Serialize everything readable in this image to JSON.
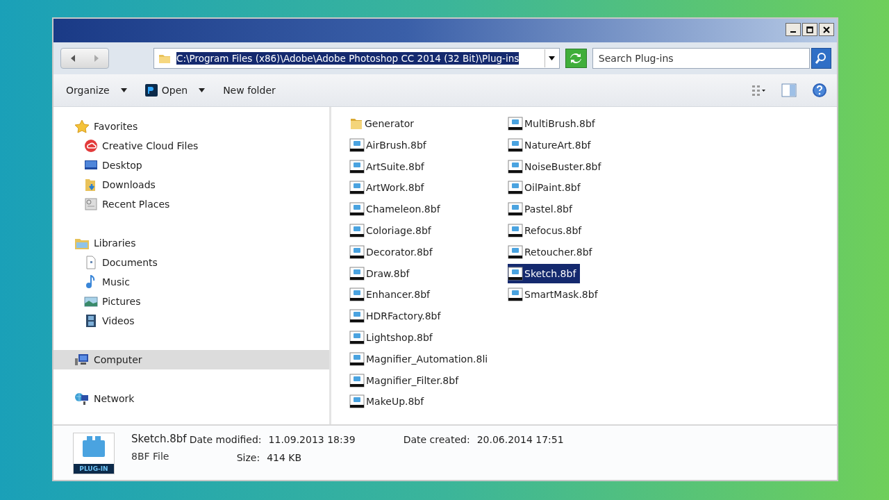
{
  "address_bar": {
    "path": "C:\\Program Files (x86)\\Adobe\\Adobe Photoshop CC 2014 (32 Bit)\\Plug-ins",
    "path_selected": true
  },
  "search": {
    "placeholder": "Search Plug-ins"
  },
  "toolbar": [
    {
      "label": "Organize",
      "dropdown": true
    },
    {
      "label": "Open",
      "dropdown": true
    },
    {
      "label": "New folder",
      "dropdown": false
    }
  ],
  "sidebar": [
    {
      "label": "Favorites",
      "selected": false,
      "children": [
        {
          "label": "Creative Cloud Files",
          "selected": false
        },
        {
          "label": "Desktop",
          "selected": false
        },
        {
          "label": "Downloads",
          "selected": false
        },
        {
          "label": "Recent Places",
          "selected": false
        }
      ]
    },
    {
      "label": "Libraries",
      "selected": false,
      "children": [
        {
          "label": "Documents",
          "selected": false
        },
        {
          "label": "Music",
          "selected": false
        },
        {
          "label": "Pictures",
          "selected": false
        },
        {
          "label": "Videos",
          "selected": false
        }
      ]
    },
    {
      "label": "Computer",
      "selected": true
    },
    {
      "label": "Network",
      "selected": false
    }
  ],
  "files": [
    {
      "name": "Generator",
      "kind": "folder",
      "selected": false
    },
    {
      "name": "AirBrush.8bf",
      "kind": "plugin",
      "selected": false
    },
    {
      "name": "ArtSuite.8bf",
      "kind": "plugin",
      "selected": false
    },
    {
      "name": "ArtWork.8bf",
      "kind": "plugin",
      "selected": false
    },
    {
      "name": "Chameleon.8bf",
      "kind": "plugin",
      "selected": false
    },
    {
      "name": "Coloriage.8bf",
      "kind": "plugin",
      "selected": false
    },
    {
      "name": "Decorator.8bf",
      "kind": "plugin",
      "selected": false
    },
    {
      "name": "Draw.8bf",
      "kind": "plugin",
      "selected": false
    },
    {
      "name": "Enhancer.8bf",
      "kind": "plugin",
      "selected": false
    },
    {
      "name": "HDRFactory.8bf",
      "kind": "plugin",
      "selected": false
    },
    {
      "name": "Lightshop.8bf",
      "kind": "plugin",
      "selected": false
    },
    {
      "name": "Magnifier_Automation.8li",
      "kind": "plugin",
      "selected": false
    },
    {
      "name": "Magnifier_Filter.8bf",
      "kind": "plugin",
      "selected": false
    },
    {
      "name": "MakeUp.8bf",
      "kind": "plugin",
      "selected": false
    },
    {
      "name": "MultiBrush.8bf",
      "kind": "plugin",
      "selected": false
    },
    {
      "name": "NatureArt.8bf",
      "kind": "plugin",
      "selected": false
    },
    {
      "name": "NoiseBuster.8bf",
      "kind": "plugin",
      "selected": false
    },
    {
      "name": "OilPaint.8bf",
      "kind": "plugin",
      "selected": false
    },
    {
      "name": "Pastel.8bf",
      "kind": "plugin",
      "selected": false
    },
    {
      "name": "Refocus.8bf",
      "kind": "plugin",
      "selected": false
    },
    {
      "name": "Retoucher.8bf",
      "kind": "plugin",
      "selected": false
    },
    {
      "name": "Sketch.8bf",
      "kind": "plugin",
      "selected": true
    },
    {
      "name": "SmartMask.8bf",
      "kind": "plugin",
      "selected": false
    }
  ],
  "details": {
    "icon_label": "PLUG-IN",
    "name": "Sketch.8bf",
    "type": "8BF File",
    "fields": [
      {
        "label": "Date modified:",
        "value": "11.09.2013 18:39"
      },
      {
        "label": "Size:",
        "value": "414 KB"
      },
      {
        "label": "Date created:",
        "value": "20.06.2014 17:51"
      }
    ]
  }
}
